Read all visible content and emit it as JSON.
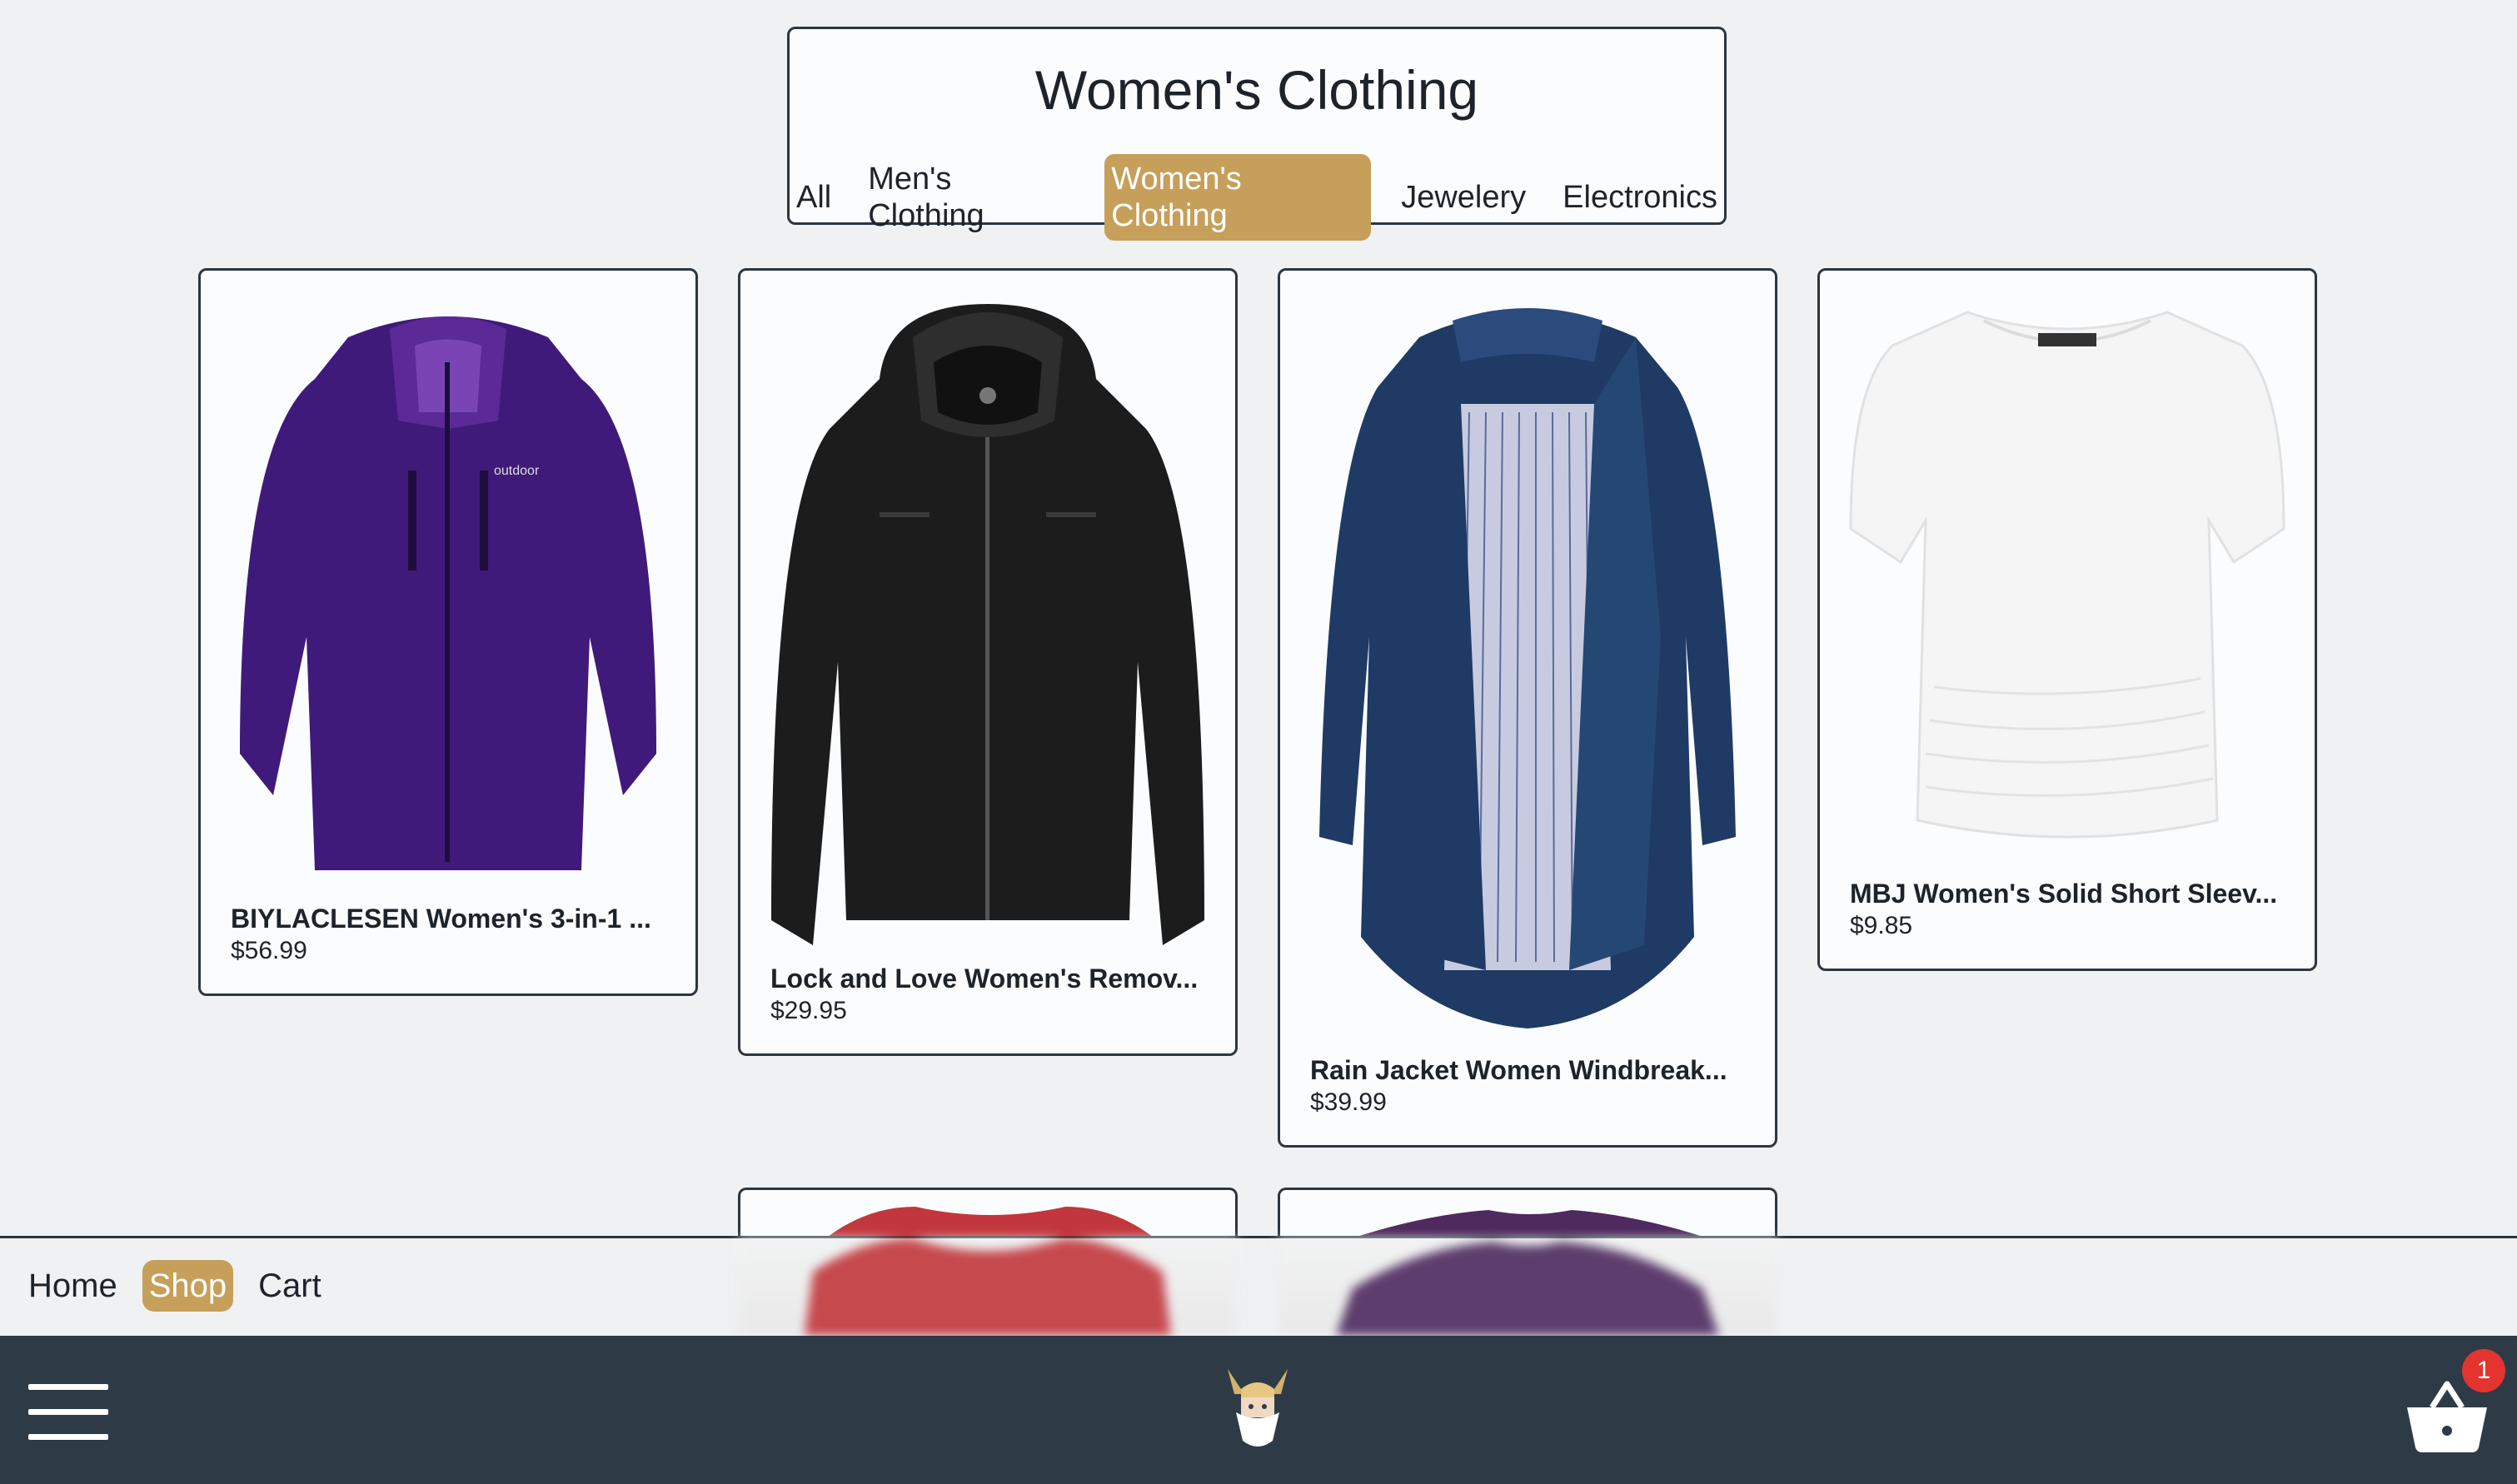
{
  "category": {
    "title": "Women's Clothing",
    "tabs": [
      {
        "label": "All",
        "active": false
      },
      {
        "label": "Men's Clothing",
        "active": false
      },
      {
        "label": "Women's Clothing",
        "active": true
      },
      {
        "label": "Jewelery",
        "active": false
      },
      {
        "label": "Electronics",
        "active": false
      }
    ]
  },
  "products": [
    {
      "title": "BIYLACLESEN Women's 3-in-1 ...",
      "price": "$56.99",
      "image_icon": "purple-jacket-image"
    },
    {
      "title": "Lock and Love Women's Remov...",
      "price": "$29.95",
      "image_icon": "black-leather-jacket-image"
    },
    {
      "title": "Rain Jacket Women Windbreak...",
      "price": "$39.99",
      "image_icon": "navy-rain-jacket-image"
    },
    {
      "title": "MBJ Women's Solid Short Sleev...",
      "price": "$9.85",
      "image_icon": "white-tshirt-image"
    }
  ],
  "page_nav": {
    "items": [
      {
        "label": "Home",
        "active": false
      },
      {
        "label": "Shop",
        "active": true
      },
      {
        "label": "Cart",
        "active": false
      }
    ]
  },
  "app_bar": {
    "menu_icon": "hamburger-menu-icon",
    "logo_icon": "viking-logo-icon",
    "cart_icon": "basket-icon",
    "cart_count": "1"
  },
  "colors": {
    "accent": "#c69f5a",
    "app_bar": "#2e3b47",
    "badge": "#e3342f",
    "page_bg": "#eff1f3"
  }
}
